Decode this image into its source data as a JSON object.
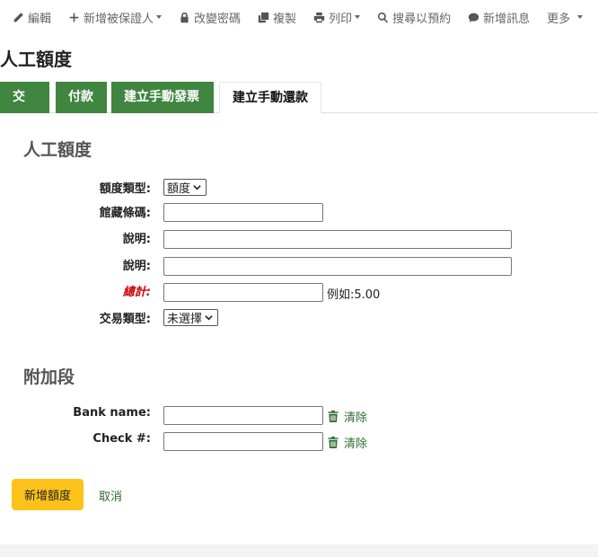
{
  "toolbar": {
    "items": [
      {
        "label": "編輯",
        "icon": "pencil-icon",
        "dropdown": false
      },
      {
        "label": "新增被保證人",
        "icon": "plus-icon",
        "dropdown": true
      },
      {
        "label": "改變密碼",
        "icon": "lock-icon",
        "dropdown": false
      },
      {
        "label": "複製",
        "icon": "copy-icon",
        "dropdown": false
      },
      {
        "label": "列印",
        "icon": "print-icon",
        "dropdown": true
      },
      {
        "label": "搜尋以預約",
        "icon": "search-icon",
        "dropdown": false
      },
      {
        "label": "新增訊息",
        "icon": "comment-icon",
        "dropdown": false
      },
      {
        "label": "更多",
        "icon": "",
        "dropdown": true
      }
    ]
  },
  "page": {
    "title": "人工額度"
  },
  "tabs": [
    {
      "label": "交易",
      "active": false
    },
    {
      "label": "付款",
      "active": false
    },
    {
      "label": "建立手動發票",
      "active": false
    },
    {
      "label": "建立手動還款",
      "active": true
    }
  ],
  "form": {
    "section_title": "人工額度",
    "credit_type": {
      "label": "額度類型:",
      "selected": "額度"
    },
    "barcode": {
      "label": "館藏條碼:",
      "value": ""
    },
    "description": {
      "label": "說明:",
      "value": ""
    },
    "note": {
      "label": "說明:",
      "value": ""
    },
    "amount": {
      "label": "總計:",
      "value": "",
      "hint": "例如:5.00"
    },
    "transaction_type": {
      "label": "交易類型:",
      "selected": "未選擇"
    }
  },
  "extra": {
    "section_title": "附加段",
    "fields": [
      {
        "label": "Bank name:",
        "value": "",
        "clear_label": "清除"
      },
      {
        "label": "Check #:",
        "value": "",
        "clear_label": "清除"
      }
    ]
  },
  "actions": {
    "submit_label": "新增額度",
    "cancel_label": "取消"
  },
  "colors": {
    "tab_green": "#408540",
    "primary_button": "#ffc21a",
    "link_green": "#2c6e2c",
    "required_red": "#cc0000"
  }
}
